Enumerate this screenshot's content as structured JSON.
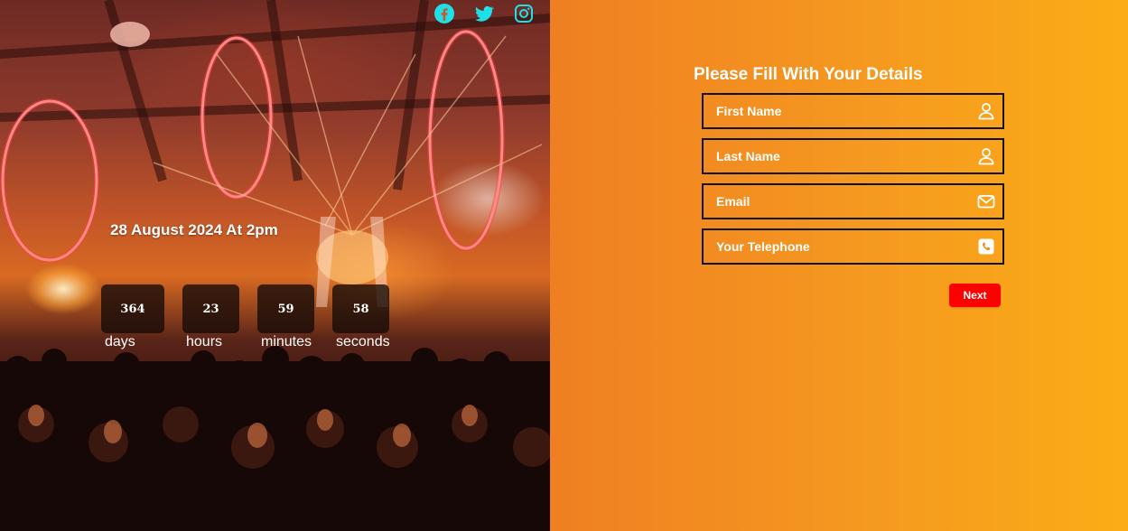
{
  "social": {
    "items": [
      {
        "name": "facebook",
        "icon": "facebook-icon"
      },
      {
        "name": "twitter",
        "icon": "twitter-icon"
      },
      {
        "name": "instagram",
        "icon": "instagram-icon"
      }
    ],
    "color": "#1ee0e8"
  },
  "event": {
    "date_text": "28 August 2024 At 2pm"
  },
  "countdown": {
    "days": {
      "value": "364",
      "label": "days"
    },
    "hours": {
      "value": "23",
      "label": "hours"
    },
    "minutes": {
      "value": "59",
      "label": "minutes"
    },
    "seconds": {
      "value": "58",
      "label": "seconds"
    }
  },
  "form": {
    "title": "Please Fill With Your Details",
    "first_name": {
      "placeholder": "First Name",
      "value": "",
      "icon": "user-icon"
    },
    "last_name": {
      "placeholder": "Last Name",
      "value": "",
      "icon": "user-icon"
    },
    "email": {
      "placeholder": "Email",
      "value": "",
      "icon": "envelope-icon"
    },
    "telephone": {
      "placeholder": "Your Telephone",
      "value": "",
      "icon": "phone-icon"
    },
    "next_label": "Next"
  },
  "colors": {
    "accent_button": "#ff0000",
    "panel_gradient_start": "#ef7f22",
    "panel_gradient_end": "#fbad16",
    "field_border": "#111111"
  }
}
